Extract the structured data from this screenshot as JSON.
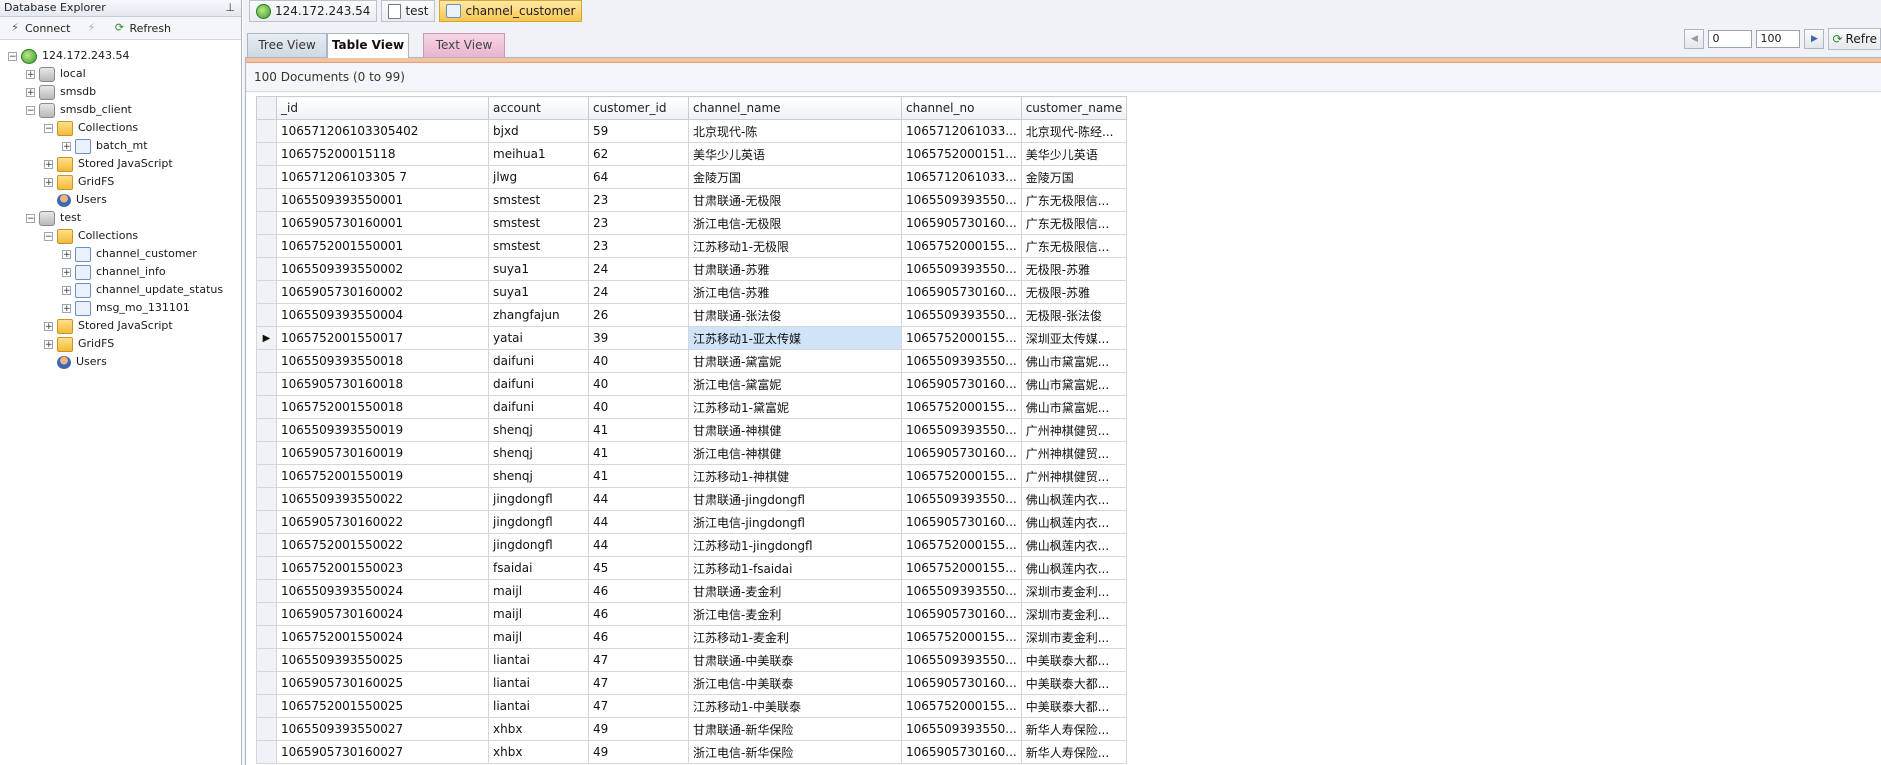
{
  "left": {
    "title": "Database Explorer",
    "connect_label": "Connect",
    "refresh_label": "Refresh",
    "tree": [
      {
        "label": "124.172.243.54",
        "icon": "server-icon",
        "level": 0,
        "exp": "-"
      },
      {
        "label": "local",
        "icon": "database-icon",
        "level": 1,
        "exp": "+"
      },
      {
        "label": "smsdb",
        "icon": "database-icon",
        "level": 1,
        "exp": "+"
      },
      {
        "label": "smsdb_client",
        "icon": "database-icon",
        "level": 1,
        "exp": "-"
      },
      {
        "label": "Collections",
        "icon": "folder-icon",
        "level": 2,
        "exp": "-"
      },
      {
        "label": "batch_mt",
        "icon": "collection-icon",
        "level": 3,
        "exp": "+"
      },
      {
        "label": "Stored JavaScript",
        "icon": "folder-icon",
        "level": 2,
        "exp": "+"
      },
      {
        "label": "GridFS",
        "icon": "folder-icon",
        "level": 2,
        "exp": "+"
      },
      {
        "label": "Users",
        "icon": "user-icon",
        "level": 2,
        "exp": ""
      },
      {
        "label": "test",
        "icon": "database-icon",
        "level": 1,
        "exp": "-"
      },
      {
        "label": "Collections",
        "icon": "folder-icon",
        "level": 2,
        "exp": "-"
      },
      {
        "label": "channel_customer",
        "icon": "collection-icon",
        "level": 3,
        "exp": "+"
      },
      {
        "label": "channel_info",
        "icon": "collection-icon",
        "level": 3,
        "exp": "+"
      },
      {
        "label": "channel_update_status",
        "icon": "collection-icon",
        "level": 3,
        "exp": "+"
      },
      {
        "label": "msg_mo_131101",
        "icon": "collection-icon",
        "level": 3,
        "exp": "+"
      },
      {
        "label": "Stored JavaScript",
        "icon": "folder-icon",
        "level": 2,
        "exp": "+"
      },
      {
        "label": "GridFS",
        "icon": "folder-icon",
        "level": 2,
        "exp": "+"
      },
      {
        "label": "Users",
        "icon": "user-icon",
        "level": 2,
        "exp": ""
      }
    ]
  },
  "doc_tabs": [
    "124.172.243.54",
    "test",
    "channel_customer"
  ],
  "view_tabs": {
    "tree": "Tree View",
    "table": "Table View",
    "text": "Text View"
  },
  "paging": {
    "start": "0",
    "count": "100",
    "refresh_label": "Refre"
  },
  "doc_count": "100 Documents (0 to 99)",
  "columns": [
    "_id",
    "account",
    "customer_id",
    "channel_name",
    "channel_no",
    "customer_name"
  ],
  "rows": [
    [
      "106571206103305402",
      "bjxd",
      "59",
      "北京现代-陈",
      "1065712061033...",
      "北京现代-陈经..."
    ],
    [
      "106575200015118",
      "meihua1",
      "62",
      "美华少儿英语",
      "1065752000151...",
      "美华少儿英语"
    ],
    [
      "106571206103305 7",
      "jlwg",
      "64",
      "金陵万国",
      "1065712061033...",
      "金陵万国"
    ],
    [
      "1065509393550001",
      "smstest",
      "23",
      "甘肃联通-无极限",
      "1065509393550...",
      "广东无极限信..."
    ],
    [
      "1065905730160001",
      "smstest",
      "23",
      "浙江电信-无极限",
      "1065905730160...",
      "广东无极限信..."
    ],
    [
      "1065752001550001",
      "smstest",
      "23",
      "江苏移动1-无极限",
      "1065752000155...",
      "广东无极限信..."
    ],
    [
      "1065509393550002",
      "suya1",
      "24",
      "甘肃联通-苏雅",
      "1065509393550...",
      "无极限-苏雅"
    ],
    [
      "1065905730160002",
      "suya1",
      "24",
      "浙江电信-苏雅",
      "1065905730160...",
      "无极限-苏雅"
    ],
    [
      "1065509393550004",
      "zhangfajun",
      "26",
      "甘肃联通-张法俊",
      "1065509393550...",
      "无极限-张法俊"
    ],
    [
      "1065752001550017",
      "yatai",
      "39",
      "江苏移动1-亚太传媒",
      "1065752000155...",
      "深圳亚太传媒..."
    ],
    [
      "1065509393550018",
      "daifuni",
      "40",
      "甘肃联通-黛富妮",
      "1065509393550...",
      "佛山市黛富妮..."
    ],
    [
      "1065905730160018",
      "daifuni",
      "40",
      "浙江电信-黛富妮",
      "1065905730160...",
      "佛山市黛富妮..."
    ],
    [
      "1065752001550018",
      "daifuni",
      "40",
      "江苏移动1-黛富妮",
      "1065752000155...",
      "佛山市黛富妮..."
    ],
    [
      "1065509393550019",
      "shenqj",
      "41",
      "甘肃联通-神棋健",
      "1065509393550...",
      "广州神棋健贸..."
    ],
    [
      "1065905730160019",
      "shenqj",
      "41",
      "浙江电信-神棋健",
      "1065905730160...",
      "广州神棋健贸..."
    ],
    [
      "1065752001550019",
      "shenqj",
      "41",
      "江苏移动1-神棋健",
      "1065752000155...",
      "广州神棋健贸..."
    ],
    [
      "1065509393550022",
      "jingdongfl",
      "44",
      "甘肃联通-jingdongfl",
      "1065509393550...",
      "佛山枫莲内衣..."
    ],
    [
      "1065905730160022",
      "jingdongfl",
      "44",
      "浙江电信-jingdongfl",
      "1065905730160...",
      "佛山枫莲内衣..."
    ],
    [
      "1065752001550022",
      "jingdongfl",
      "44",
      "江苏移动1-jingdongfl",
      "1065752000155...",
      "佛山枫莲内衣..."
    ],
    [
      "1065752001550023",
      "fsaidai",
      "45",
      "江苏移动1-fsaidai",
      "1065752000155...",
      "佛山枫莲内衣..."
    ],
    [
      "1065509393550024",
      "maijl",
      "46",
      "甘肃联通-麦金利",
      "1065509393550...",
      "深圳市麦金利..."
    ],
    [
      "1065905730160024",
      "maijl",
      "46",
      "浙江电信-麦金利",
      "1065905730160...",
      "深圳市麦金利..."
    ],
    [
      "1065752001550024",
      "maijl",
      "46",
      "江苏移动1-麦金利",
      "1065752000155...",
      "深圳市麦金利..."
    ],
    [
      "1065509393550025",
      "liantai",
      "47",
      "甘肃联通-中美联泰",
      "1065509393550...",
      "中美联泰大都..."
    ],
    [
      "1065905730160025",
      "liantai",
      "47",
      "浙江电信-中美联泰",
      "1065905730160...",
      "中美联泰大都..."
    ],
    [
      "1065752001550025",
      "liantai",
      "47",
      "江苏移动1-中美联泰",
      "1065752000155...",
      "中美联泰大都..."
    ],
    [
      "1065509393550027",
      "xhbx",
      "49",
      "甘肃联通-新华保险",
      "1065509393550...",
      "新华人寿保险..."
    ],
    [
      "1065905730160027",
      "xhbx",
      "49",
      "浙江电信-新华保险",
      "1065905730160...",
      "新华人寿保险..."
    ]
  ],
  "selected_row": 9
}
